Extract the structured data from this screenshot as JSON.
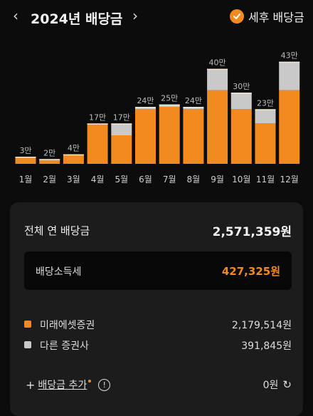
{
  "header": {
    "prev_icon": "chevron-left-icon",
    "prev_glyph": "‹",
    "title": "2024년 배당금",
    "next_icon": "chevron-right-icon",
    "next_glyph": "›",
    "tax_toggle_label": "세후 배당금",
    "tax_toggle_checked": true
  },
  "chart_data": {
    "type": "bar",
    "categories": [
      "1월",
      "2월",
      "3월",
      "4월",
      "5월",
      "6월",
      "7월",
      "8월",
      "9월",
      "10월",
      "11월",
      "12월"
    ],
    "series": [
      {
        "values": [
          3,
          2,
          4,
          17,
          12,
          23,
          24,
          23,
          31,
          23,
          17,
          31
        ],
        "color": "#f28a1f"
      },
      {
        "values": [
          0,
          0,
          0,
          0,
          5,
          1,
          1,
          1,
          9,
          7,
          6,
          12
        ],
        "color": "#c9c9c9"
      }
    ],
    "data_labels": [
      "3만",
      "2만",
      "4만",
      "17만",
      "17만",
      "24만",
      "25만",
      "24만",
      "40만",
      "30만",
      "23만",
      "43만"
    ],
    "ylim": [
      0,
      45
    ],
    "grid": false,
    "stacked": true
  },
  "summary": {
    "total_label": "전체 연 배당금",
    "total_value": "2,571,359원",
    "tax_label": "배당소득세",
    "tax_value": "427,325원"
  },
  "brokers": [
    {
      "name": "미래에셋증권",
      "value": "2,179,514원",
      "color": "#f28a1f"
    },
    {
      "name": "다른 증권사",
      "value": "391,845원",
      "color": "#c9c9c9"
    }
  ],
  "footer": {
    "add_plus": "+",
    "add_label": "배당금 추가",
    "info_glyph": "!",
    "refresh_value": "0원",
    "refresh_icon": "refresh-icon",
    "refresh_glyph": "↻"
  },
  "colors": {
    "accent": "#f28a1f",
    "other": "#c9c9c9",
    "background": "#0c0c0c",
    "panel": "#1c1c1c"
  }
}
